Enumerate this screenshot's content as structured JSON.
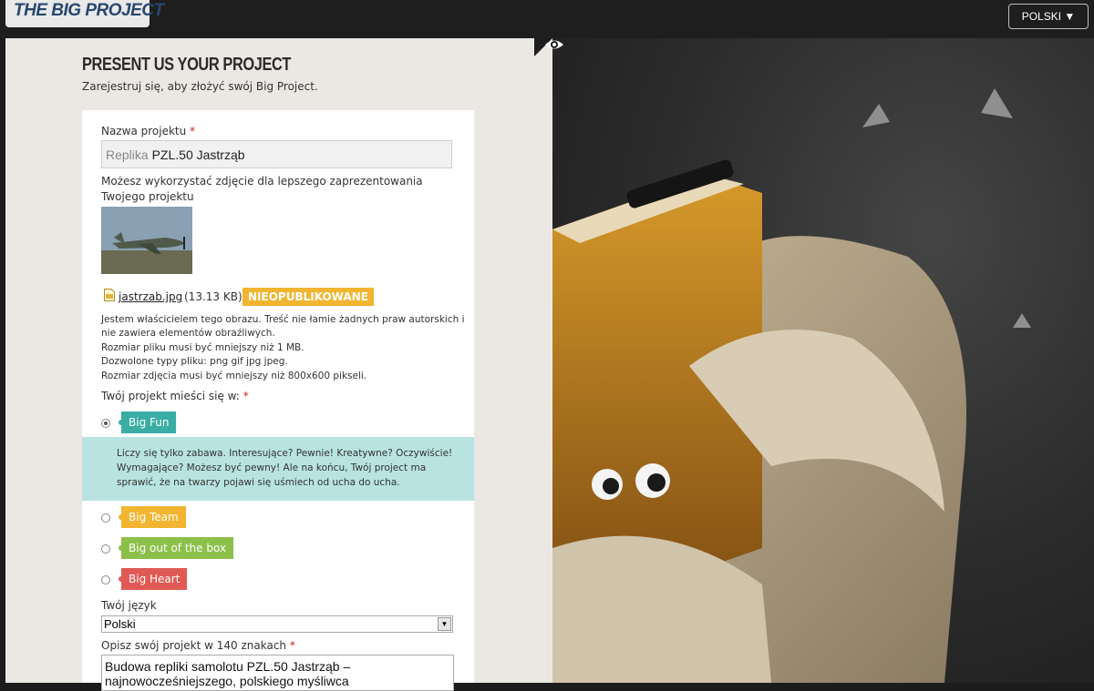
{
  "topbar": {
    "logo_text": "THE BIG PROJECT",
    "language_button": "POLSKI ▼"
  },
  "panel": {
    "title": "PRESENT US YOUR PROJECT",
    "subtitle": "Zarejestruj się, aby złożyć swój Big Project."
  },
  "form": {
    "project_name_label": "Nazwa projektu",
    "required_mark": "*",
    "project_name_placeholder": "Replika",
    "project_name_value": "PZL.50 Jastrząb",
    "photo_hint_line1": "Możesz wykorzystać zdjęcie dla lepszego zaprezentowania",
    "photo_hint_line2": "Twojego projektu",
    "file_name": "jastrzab.jpg",
    "file_size": "(13.13 KB)",
    "file_status": "NIEOPUBLIKOWANE",
    "notes": [
      "Jestem właścicielem tego obrazu. Treść nie łamie żadnych praw autorskich i",
      "nie zawiera elementów obraźliwych.",
      "Rozmiar pliku musi być mniejszy niż 1 MB.",
      "Dozwolone typy pliku: png gif jpg jpeg.",
      "Rozmiar zdjęcia musi być mniejszy niż 800x600 pikseli."
    ],
    "category_label": "Twój projekt mieści się w:",
    "categories": [
      {
        "label": "Big Fun",
        "color": "#3aaea5",
        "selected": true
      },
      {
        "label": "Big Team",
        "color": "#f2b531",
        "selected": false
      },
      {
        "label": "Big out of the box",
        "color": "#8cc04a",
        "selected": false
      },
      {
        "label": "Big Heart",
        "color": "#e05a55",
        "selected": false
      }
    ],
    "category_description": [
      "Liczy się tylko zabawa. Interesujące? Pewnie! Kreatywne? Oczywiście!",
      "Wymagające? Możesz być pewny! Ale na końcu, Twój project ma",
      "sprawić, że na twarzy pojawi się uśmiech od ucha do ucha."
    ],
    "language_label": "Twój język",
    "language_value": "Polski",
    "description_label": "Opisz swój projekt w 140 znakach",
    "description_value_line1": "Budowa repliki samolotu PZL.50 Jastrząb –",
    "description_value_line2": "najnowocześniejszego, polskiego myśliwca"
  },
  "colors": {
    "panel_bg": "#ebe8e3",
    "topbar_bg": "#1e1e1e",
    "description_box": "#b8e3e0",
    "required": "#cc2222"
  }
}
